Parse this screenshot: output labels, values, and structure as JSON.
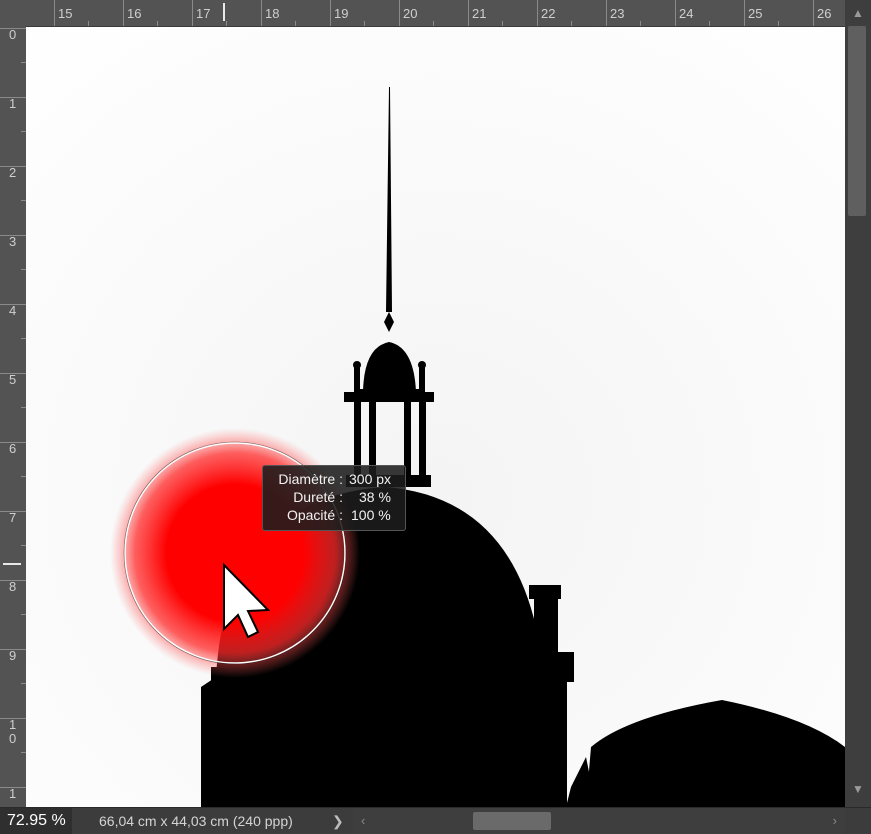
{
  "ruler": {
    "top_labels": [
      "15",
      "16",
      "17",
      "18",
      "19",
      "20",
      "21",
      "22",
      "23",
      "24",
      "25",
      "26"
    ],
    "left_labels": [
      "0",
      "1",
      "2",
      "3",
      "4",
      "5",
      "6",
      "7",
      "8",
      "9",
      "1\n0",
      "1"
    ]
  },
  "brush_tooltip": {
    "diameter_label": "Diamètre :",
    "diameter_value": "300 px",
    "hardness_label": "Dureté :",
    "hardness_value": "38 %",
    "opacity_label": "Opacité :",
    "opacity_value": "100 %"
  },
  "brush": {
    "color": "#ff0000",
    "hardness_percent": 38,
    "opacity_percent": 100
  },
  "status": {
    "zoom": "72.95 %",
    "doc_size": "66,04 cm x 44,03 cm (240 ppp)",
    "more_arrow": "❯"
  },
  "scroll": {
    "up": "▲",
    "down": "▼",
    "left": "‹",
    "right": "›"
  }
}
